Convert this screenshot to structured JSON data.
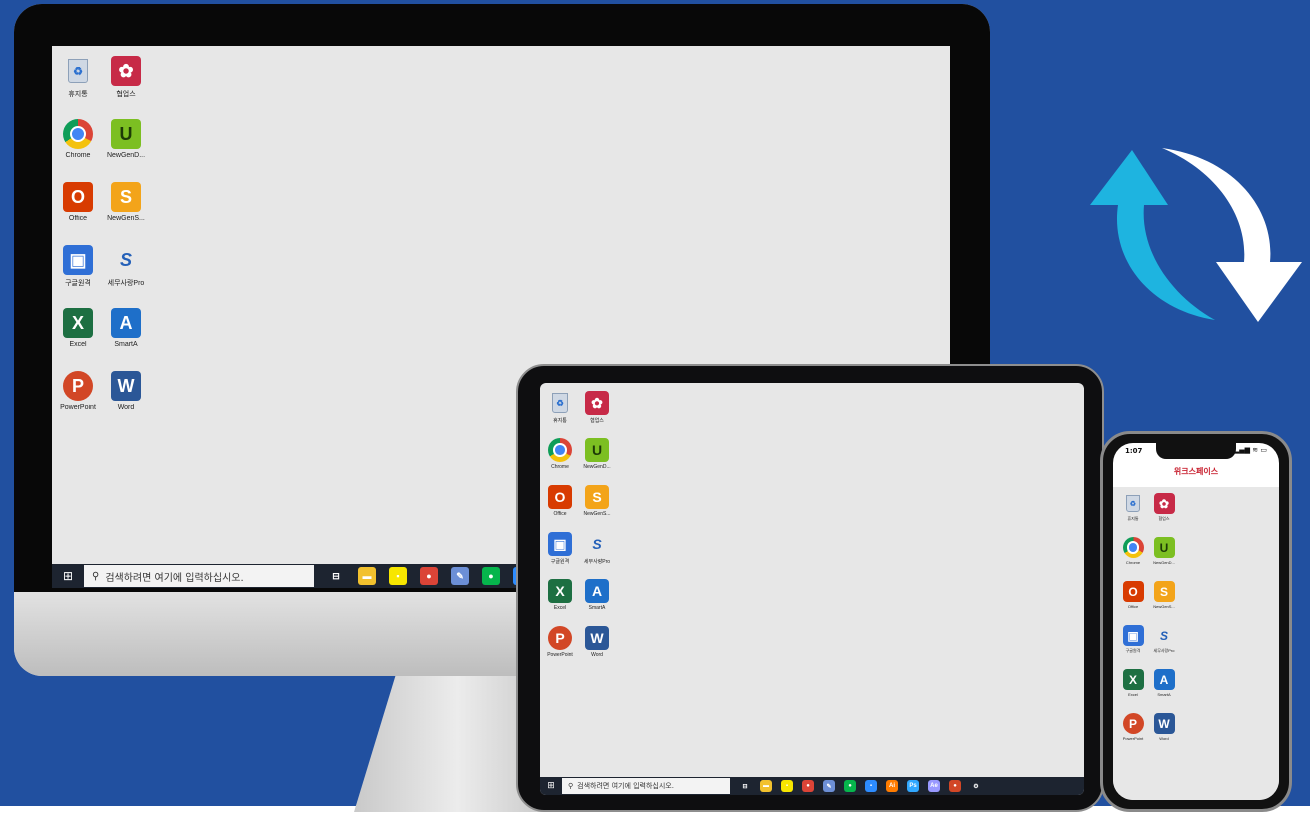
{
  "desktop": {
    "icons": [
      {
        "label": "휴지통",
        "glyph": "♻",
        "icon": "recycle-bin-icon"
      },
      {
        "label": "협업스",
        "glyph": "✿",
        "icon": "collab-app-icon"
      },
      {
        "label": "Chrome",
        "glyph": "",
        "icon": "chrome-icon"
      },
      {
        "label": "NewGenD...",
        "glyph": "U",
        "icon": "newgen-u-icon"
      },
      {
        "label": "Office",
        "glyph": "O",
        "icon": "office-icon"
      },
      {
        "label": "NewGenS...",
        "glyph": "S",
        "icon": "newgen-s-icon"
      },
      {
        "label": "구글원격",
        "glyph": "▣",
        "icon": "remote-desktop-icon"
      },
      {
        "label": "세무사랑Pro",
        "glyph": "S",
        "icon": "tax-pro-icon"
      },
      {
        "label": "Excel",
        "glyph": "X",
        "icon": "excel-icon"
      },
      {
        "label": "SmartA",
        "glyph": "A",
        "icon": "smarta-icon"
      },
      {
        "label": "PowerPoint",
        "glyph": "P",
        "icon": "powerpoint-icon"
      },
      {
        "label": "Word",
        "glyph": "W",
        "icon": "word-icon"
      }
    ]
  },
  "taskbar": {
    "start_glyph": "⊞",
    "search_glyph": "⚲",
    "search_placeholder": "검색하려면 여기에 입력하십시오.",
    "monitor_apps": [
      {
        "glyph": "⊟",
        "icon": "task-view-icon",
        "color": "#1d2430"
      },
      {
        "glyph": "▬",
        "icon": "file-explorer-icon",
        "color": "#f2c12e"
      },
      {
        "glyph": "▪",
        "icon": "kakaotalk-icon",
        "color": "#f7e600"
      },
      {
        "glyph": "●",
        "icon": "chrome-taskbar-icon",
        "color": "#db4437"
      },
      {
        "glyph": "✎",
        "icon": "paint-icon",
        "color": "#6c8fd6"
      },
      {
        "glyph": "●",
        "icon": "line-messenger-icon",
        "color": "#06b54c"
      },
      {
        "glyph": "▪",
        "icon": "zoom-icon",
        "color": "#2d8cff"
      }
    ],
    "ipad_apps": [
      {
        "glyph": "⊟",
        "icon": "task-view-icon",
        "color": "#1d2430"
      },
      {
        "glyph": "▬",
        "icon": "file-explorer-icon",
        "color": "#f2c12e"
      },
      {
        "glyph": "▪",
        "icon": "kakaotalk-icon",
        "color": "#f7e600"
      },
      {
        "glyph": "●",
        "icon": "chrome-taskbar-icon",
        "color": "#db4437"
      },
      {
        "glyph": "✎",
        "icon": "paint-icon",
        "color": "#6c8fd6"
      },
      {
        "glyph": "●",
        "icon": "line-messenger-icon",
        "color": "#06b54c"
      },
      {
        "glyph": "▪",
        "icon": "zoom-icon",
        "color": "#2d8cff"
      },
      {
        "glyph": "Ai",
        "icon": "illustrator-icon",
        "color": "#ff7c00"
      },
      {
        "glyph": "Ps",
        "icon": "photoshop-icon",
        "color": "#31a8ff"
      },
      {
        "glyph": "Ae",
        "icon": "after-effects-icon",
        "color": "#9999ff"
      },
      {
        "glyph": "●",
        "icon": "powerpoint-taskbar-icon",
        "color": "#d24726"
      },
      {
        "glyph": "⚙",
        "icon": "settings-icon",
        "color": "#1d2430"
      }
    ]
  },
  "phone": {
    "time": "1:07",
    "status_icons": "▂▄▆ ≋ ▭",
    "app_title": "위크스페이스"
  },
  "colors": {
    "background": "#2150a0",
    "sync_arrow_cyan": "#1eb4e0",
    "sync_arrow_white": "#ffffff",
    "phone_title": "#c8202f"
  }
}
